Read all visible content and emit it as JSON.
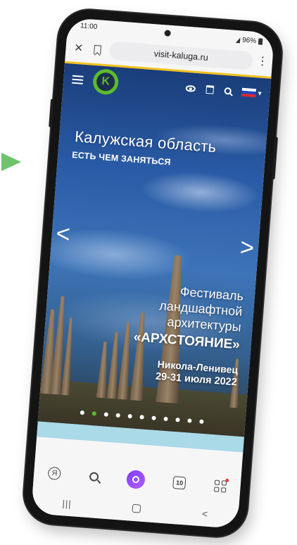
{
  "status_bar": {
    "time": "11:00",
    "battery": "96%"
  },
  "browser": {
    "url": "visit-kaluga.ru",
    "close_label": "×"
  },
  "site": {
    "logo_letter": "K",
    "title": "Калужская область",
    "subtitle": "ЕСТЬ ЧЕМ ЗАНЯТЬСЯ",
    "prev_arrow": "<",
    "next_arrow": ">"
  },
  "slide": {
    "line1": "Фестиваль",
    "line2": "ландшафтной",
    "line3": "архитектуры",
    "name": "«АРХСТОЯНИЕ»",
    "place": "Никола-Ленивец",
    "dates": "29-31 июля 2022"
  },
  "carousel": {
    "total": 11,
    "active_index": 1
  },
  "bottom_bar": {
    "yandex_label": "Я",
    "tabs_count": "10"
  },
  "colors": {
    "accent_green": "#5dbb2b",
    "load_bar": "#f3c11a",
    "pointer": "#6fc36b",
    "flag": [
      "#ffffff",
      "#1c48c4",
      "#e0282e"
    ]
  },
  "icons": [
    "menu-icon",
    "eye-icon",
    "calendar-icon",
    "search-icon",
    "flag-icon",
    "bookmark-icon",
    "services-icon"
  ]
}
